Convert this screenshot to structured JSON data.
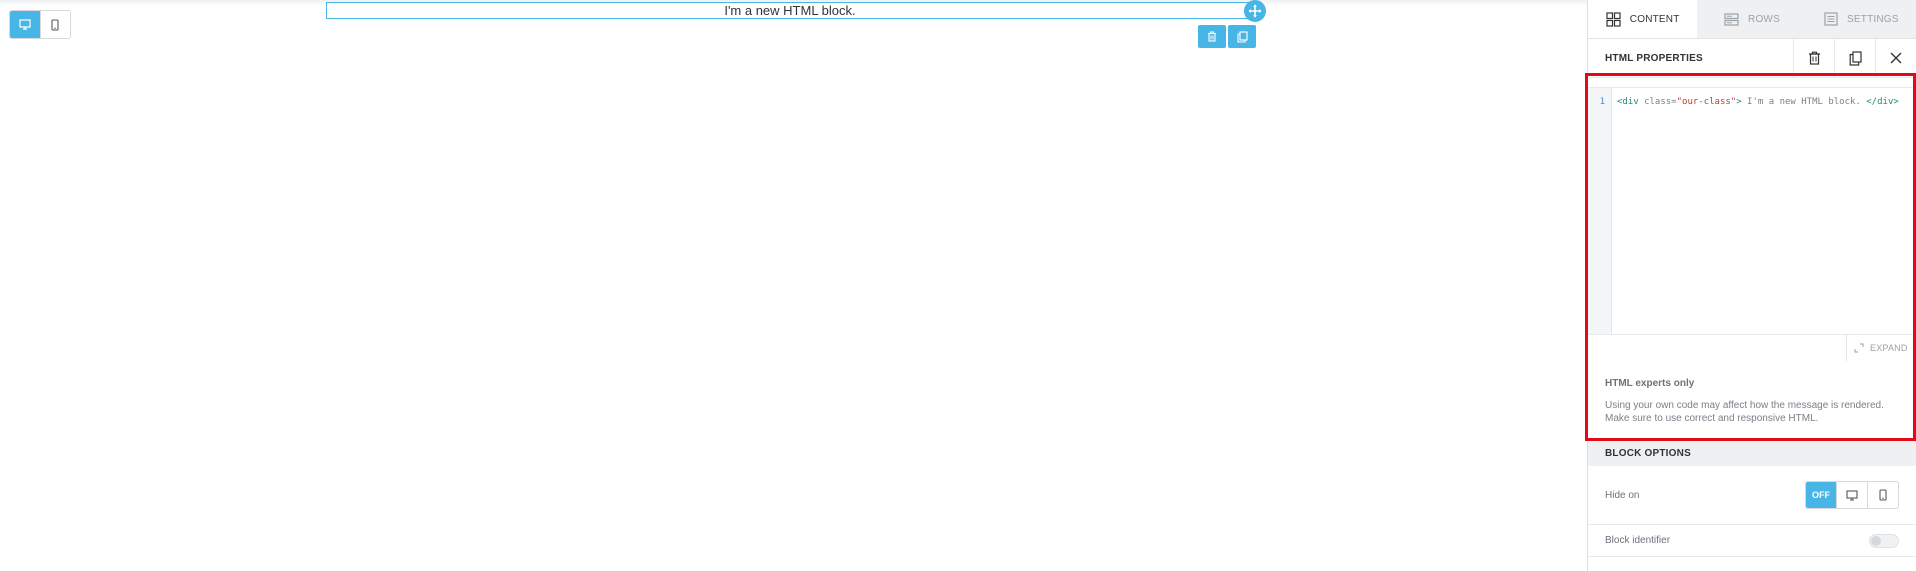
{
  "canvas": {
    "device_toggle": [
      {
        "name": "desktop",
        "icon": "desktop-icon",
        "active": true
      },
      {
        "name": "mobile",
        "icon": "mobile-icon",
        "active": false
      }
    ],
    "html_block": {
      "text": "I'm a new HTML block."
    },
    "block_actions": [
      {
        "icon": "trash-icon",
        "action": "delete"
      },
      {
        "icon": "duplicate-icon",
        "action": "duplicate"
      }
    ]
  },
  "panel": {
    "tabs": [
      {
        "label": "CONTENT",
        "icon": "grid-icon",
        "active": true
      },
      {
        "label": "ROWS",
        "icon": "rows-icon",
        "active": false
      },
      {
        "label": "SETTINGS",
        "icon": "settings-list-icon",
        "active": false
      }
    ],
    "properties_title": "HTML PROPERTIES",
    "header_actions": [
      {
        "icon": "trash-icon"
      },
      {
        "icon": "duplicate-icon"
      },
      {
        "icon": "close-icon"
      }
    ],
    "editor": {
      "line_number": "1",
      "code": {
        "open_tag": "<div ",
        "attr": "class=",
        "value": "\"our-class\"",
        "close_open": ">",
        "text": " I'm a new HTML block. ",
        "close_tag": "</div>"
      },
      "expand_label": "EXPAND"
    },
    "note": {
      "title": "HTML experts only",
      "body": "Using your own code may affect how the message is rendered. Make sure to use correct and responsive HTML."
    },
    "block_options": {
      "title": "BLOCK OPTIONS",
      "hide_on_label": "Hide on",
      "hide_on_off": "OFF",
      "block_identifier_label": "Block identifier",
      "block_identifier_on": false
    }
  },
  "colors": {
    "accent": "#47b5e6",
    "highlight": "#e10b17"
  }
}
